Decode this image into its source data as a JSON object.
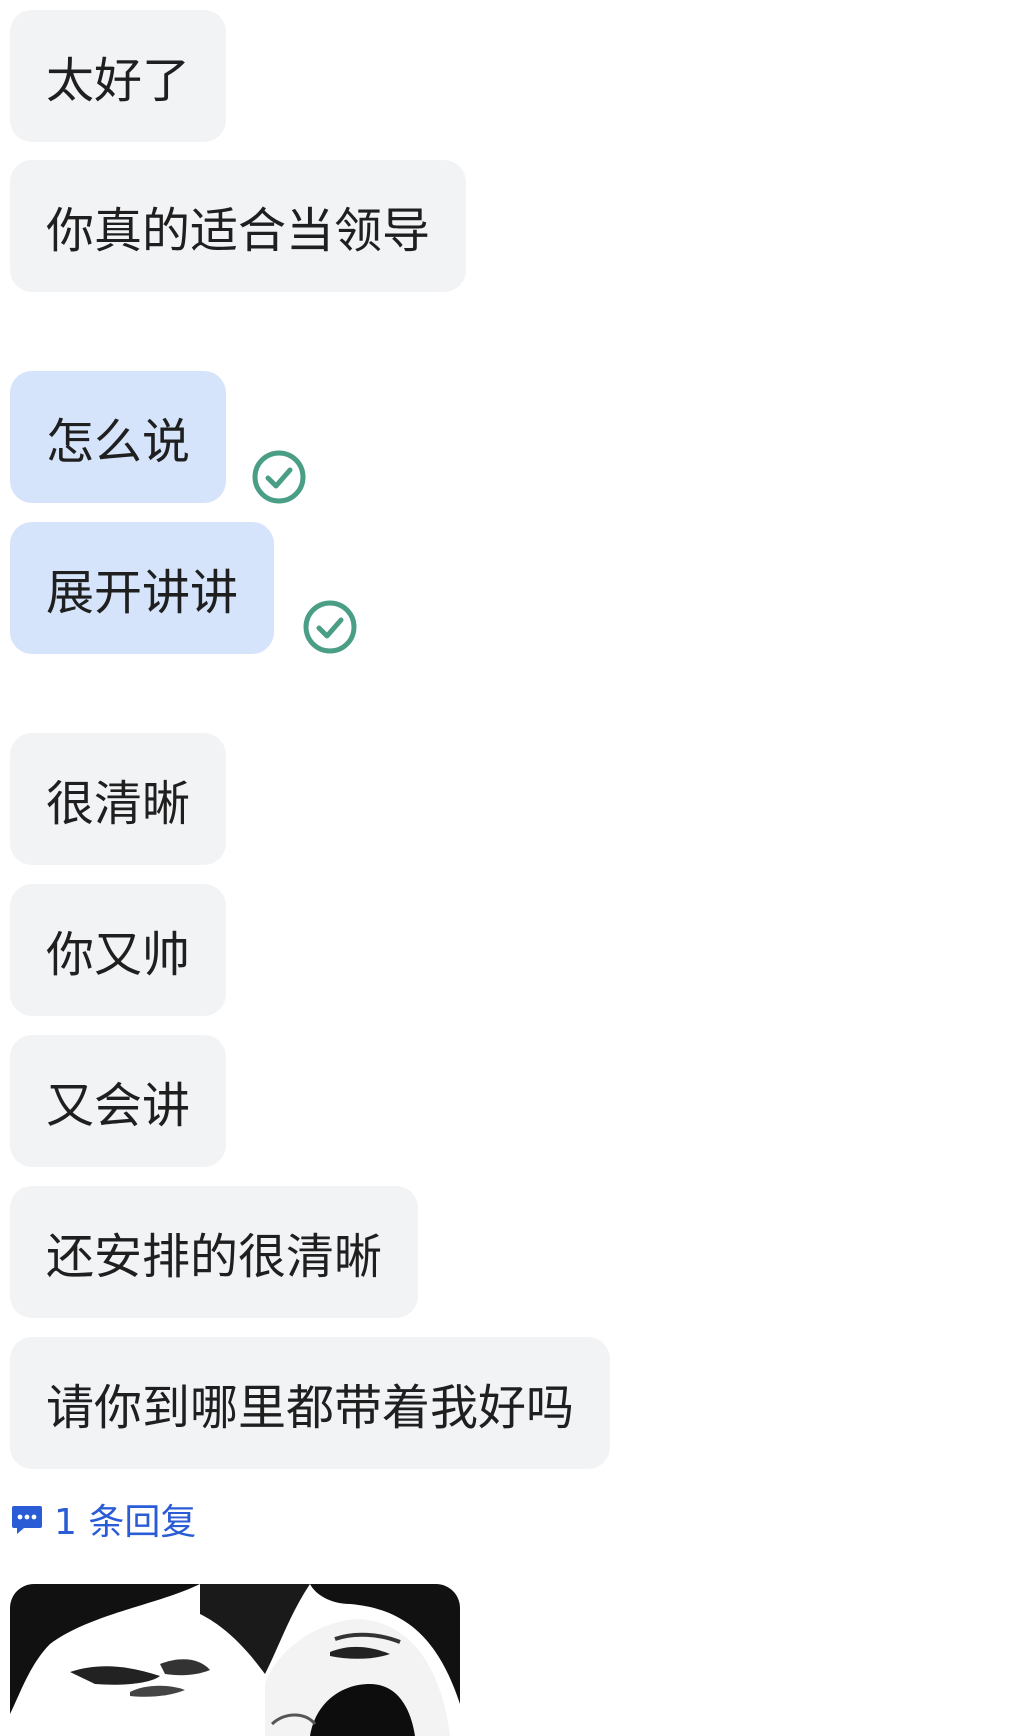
{
  "messages": [
    {
      "text": "太好了",
      "direction": "incoming"
    },
    {
      "text": "你真的适合当领导",
      "direction": "incoming"
    },
    {
      "text": "怎么说",
      "direction": "outgoing",
      "status": "read"
    },
    {
      "text": "展开讲讲",
      "direction": "outgoing",
      "status": "read"
    },
    {
      "text": "很清晰",
      "direction": "incoming"
    },
    {
      "text": "你又帅",
      "direction": "incoming"
    },
    {
      "text": "又会讲",
      "direction": "incoming"
    },
    {
      "text": "还安排的很清晰",
      "direction": "incoming"
    },
    {
      "text": "请你到哪里都带着我好吗",
      "direction": "incoming"
    }
  ],
  "reply_link": {
    "label": "1 条回复",
    "icon": "comment-bubble-icon"
  },
  "sticker": {
    "icon": "meme-sticker-image"
  },
  "colors": {
    "incoming_bubble": "#f2f3f5",
    "outgoing_bubble": "#d6e4fb",
    "read_check": "#4a9e86",
    "link": "#2a5cd6"
  }
}
